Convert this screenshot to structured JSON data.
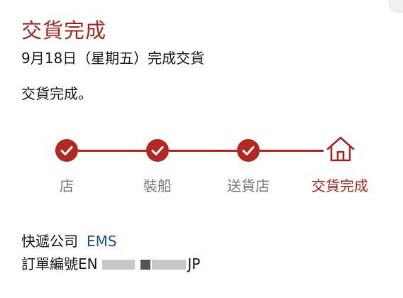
{
  "header": {
    "title": "交貨完成",
    "date": "9月18日（星期五）完成交貨",
    "note": "交貨完成。"
  },
  "steps": [
    {
      "label": "店",
      "status": "done",
      "icon": "check-icon"
    },
    {
      "label": "裝船",
      "status": "done",
      "icon": "check-icon"
    },
    {
      "label": "送貨店",
      "status": "done",
      "icon": "check-icon"
    },
    {
      "label": "交貨完成",
      "status": "current",
      "icon": "home-icon"
    }
  ],
  "shipping": {
    "carrier_label": "快遞公司",
    "carrier_value": "EMS",
    "order_label": "訂單編號",
    "order_prefix": "EN",
    "order_suffix": "JP"
  },
  "colors": {
    "accent": "#b5271f",
    "link": "#1f55a6",
    "muted": "#7a7a7a",
    "text": "#202020"
  }
}
